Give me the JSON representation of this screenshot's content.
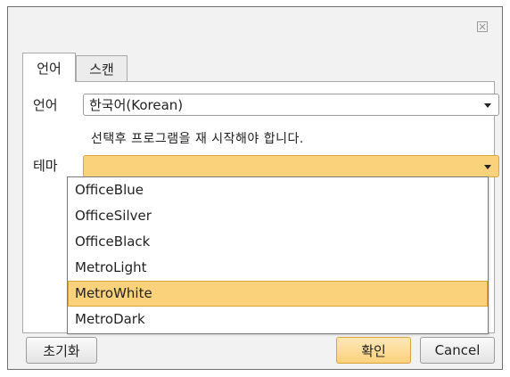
{
  "dialog": {
    "close_symbol": "X"
  },
  "tabs": [
    {
      "label": "언어",
      "active": true
    },
    {
      "label": "스캔",
      "active": false
    }
  ],
  "language": {
    "label": "언어",
    "selected": "한국어(Korean)",
    "note": "선택후 프로그램을 재 시작해야 합니다."
  },
  "theme": {
    "label": "테마",
    "selected": "",
    "options": [
      "OfficeBlue",
      "OfficeSilver",
      "OfficeBlack",
      "MetroLight",
      "MetroWhite",
      "MetroDark"
    ],
    "highlighted": "MetroWhite"
  },
  "buttons": {
    "reset": "초기화",
    "ok": "확인",
    "cancel": "Cancel"
  },
  "colors": {
    "accent": "#fbd27c",
    "accent_border": "#d9a53a"
  }
}
